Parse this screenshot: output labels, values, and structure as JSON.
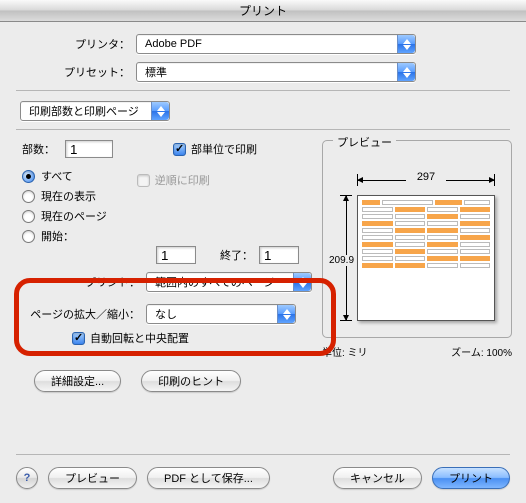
{
  "title": "プリント",
  "printer": {
    "label": "プリンタ：",
    "value": "Adobe PDF"
  },
  "preset": {
    "label": "プリセット：",
    "value": "標準"
  },
  "section_select": "印刷部数と印刷ページ",
  "copies": {
    "label": "部数：",
    "value": "1"
  },
  "collate": {
    "label": "部単位で印刷",
    "checked": true
  },
  "reverse": {
    "label": "逆順に印刷",
    "checked": false
  },
  "range": {
    "all": "すべて",
    "current_view": "現在の表示",
    "current_page": "現在のページ",
    "start": "開始：",
    "from_val": "1",
    "to_label": "終了：",
    "to_val": "1",
    "selected": "all"
  },
  "print_pages": {
    "label": "プリント：",
    "value": "範囲内のすべてのページ"
  },
  "scaling": {
    "label": "ページの拡大／縮小：",
    "value": "なし"
  },
  "auto_rotate": {
    "label": "自動回転と中央配置",
    "checked": true
  },
  "preview": {
    "legend": "プレビュー",
    "width": "297",
    "height": "209.9",
    "unit_label": "単位: ミリ",
    "zoom_label": "ズーム: 100%"
  },
  "buttons": {
    "advanced": "詳細設定...",
    "hint": "印刷のヒント",
    "help": "?",
    "preview": "プレビュー",
    "save_pdf": "PDF として保存...",
    "cancel": "キャンセル",
    "print": "プリント"
  }
}
